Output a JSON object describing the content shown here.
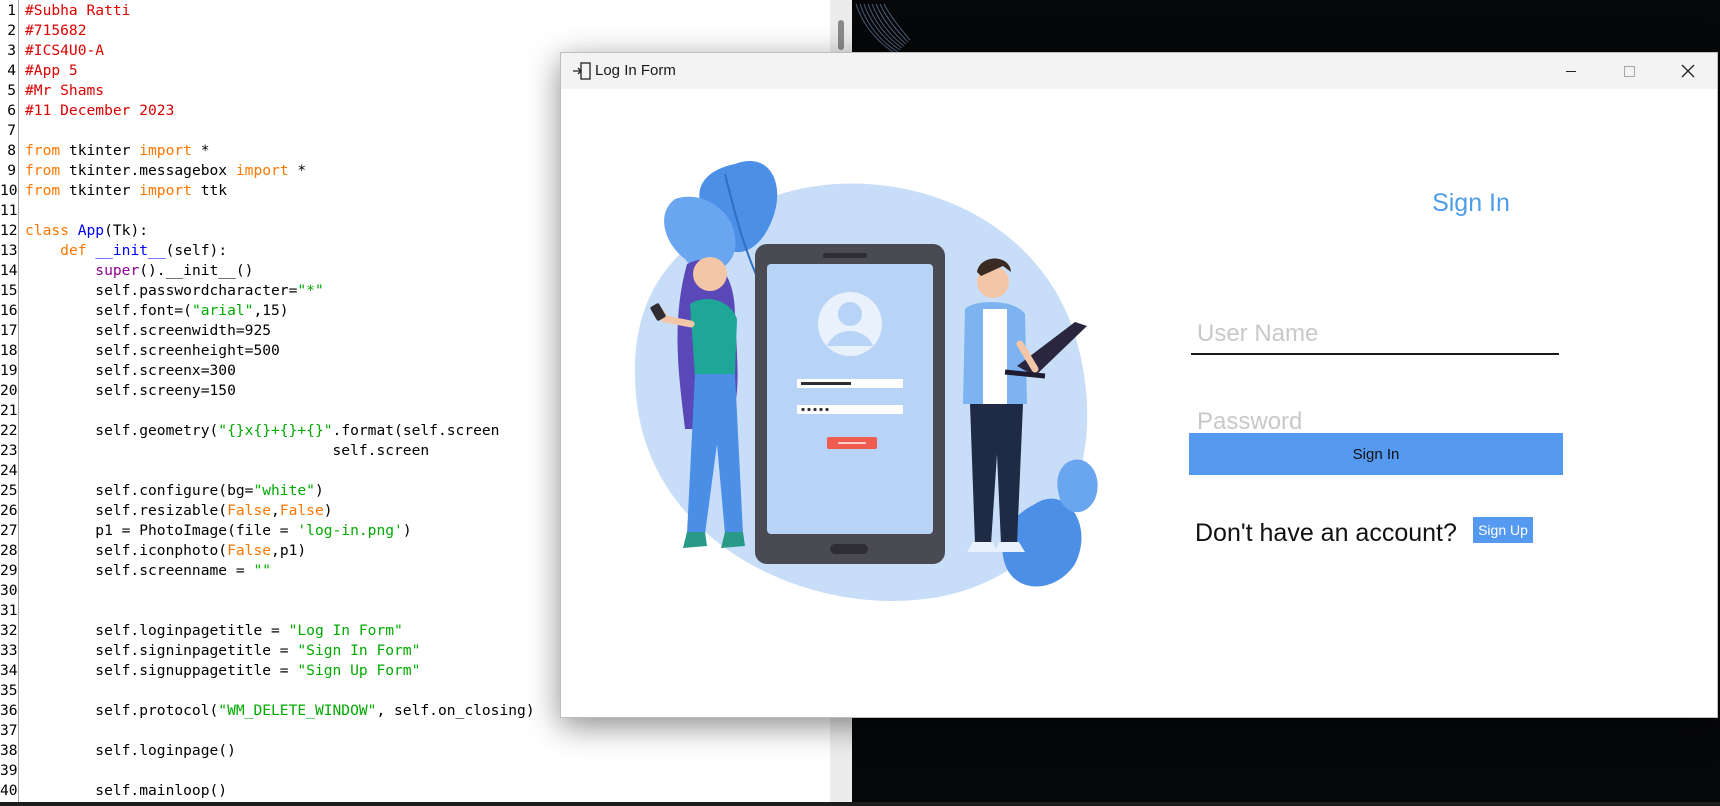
{
  "editor": {
    "lines": [
      {
        "n": "1",
        "segs": [
          {
            "t": "#Subha Ratti",
            "c": "com"
          }
        ]
      },
      {
        "n": "2",
        "segs": [
          {
            "t": "#715682",
            "c": "com"
          }
        ]
      },
      {
        "n": "3",
        "segs": [
          {
            "t": "#ICS4U0-A",
            "c": "com"
          }
        ]
      },
      {
        "n": "4",
        "segs": [
          {
            "t": "#App 5",
            "c": "com"
          }
        ]
      },
      {
        "n": "5",
        "segs": [
          {
            "t": "#Mr Shams",
            "c": "com"
          }
        ]
      },
      {
        "n": "6",
        "segs": [
          {
            "t": "#11 December 2023",
            "c": "com"
          }
        ]
      },
      {
        "n": "7",
        "segs": []
      },
      {
        "n": "8",
        "segs": [
          {
            "t": "from",
            "c": "kw"
          },
          {
            "t": " tkinter "
          },
          {
            "t": "import",
            "c": "kw"
          },
          {
            "t": " *"
          }
        ]
      },
      {
        "n": "9",
        "segs": [
          {
            "t": "from",
            "c": "kw"
          },
          {
            "t": " tkinter.messagebox "
          },
          {
            "t": "import",
            "c": "kw"
          },
          {
            "t": " *"
          }
        ]
      },
      {
        "n": "10",
        "segs": [
          {
            "t": "from",
            "c": "kw"
          },
          {
            "t": " tkinter "
          },
          {
            "t": "import",
            "c": "kw"
          },
          {
            "t": " ttk"
          }
        ]
      },
      {
        "n": "11",
        "segs": []
      },
      {
        "n": "12",
        "segs": [
          {
            "t": "class",
            "c": "kw"
          },
          {
            "t": " "
          },
          {
            "t": "App",
            "c": "def"
          },
          {
            "t": "(Tk):"
          }
        ]
      },
      {
        "n": "13",
        "segs": [
          {
            "t": "    "
          },
          {
            "t": "def",
            "c": "kw"
          },
          {
            "t": " "
          },
          {
            "t": "__init__",
            "c": "def"
          },
          {
            "t": "(self):"
          }
        ]
      },
      {
        "n": "14",
        "segs": [
          {
            "t": "        "
          },
          {
            "t": "super",
            "c": "blt"
          },
          {
            "t": "().__init__()"
          }
        ]
      },
      {
        "n": "15",
        "segs": [
          {
            "t": "        self.passwordcharacter="
          },
          {
            "t": "\"*\"",
            "c": "str"
          }
        ]
      },
      {
        "n": "16",
        "segs": [
          {
            "t": "        self.font=("
          },
          {
            "t": "\"arial\"",
            "c": "str"
          },
          {
            "t": ",15)"
          }
        ]
      },
      {
        "n": "17",
        "segs": [
          {
            "t": "        self.screenwidth=925"
          }
        ]
      },
      {
        "n": "18",
        "segs": [
          {
            "t": "        self.screenheight=500"
          }
        ]
      },
      {
        "n": "19",
        "segs": [
          {
            "t": "        self.screenx=300"
          }
        ]
      },
      {
        "n": "20",
        "segs": [
          {
            "t": "        self.screeny=150"
          }
        ]
      },
      {
        "n": "21",
        "segs": []
      },
      {
        "n": "22",
        "segs": [
          {
            "t": "        self.geometry("
          },
          {
            "t": "\"{}x{}+{}+{}\"",
            "c": "str"
          },
          {
            "t": ".format(self.screen"
          }
        ]
      },
      {
        "n": "23",
        "segs": [
          {
            "t": "                                   self.screen"
          }
        ]
      },
      {
        "n": "24",
        "segs": []
      },
      {
        "n": "25",
        "segs": [
          {
            "t": "        self.configure(bg="
          },
          {
            "t": "\"white\"",
            "c": "str"
          },
          {
            "t": ")"
          }
        ]
      },
      {
        "n": "26",
        "segs": [
          {
            "t": "        self.resizable("
          },
          {
            "t": "False",
            "c": "kw"
          },
          {
            "t": ","
          },
          {
            "t": "False",
            "c": "kw"
          },
          {
            "t": ")"
          }
        ]
      },
      {
        "n": "27",
        "segs": [
          {
            "t": "        p1 = PhotoImage(file = "
          },
          {
            "t": "'log-in.png'",
            "c": "str"
          },
          {
            "t": ")"
          }
        ]
      },
      {
        "n": "28",
        "segs": [
          {
            "t": "        self.iconphoto("
          },
          {
            "t": "False",
            "c": "kw"
          },
          {
            "t": ",p1)"
          }
        ]
      },
      {
        "n": "29",
        "segs": [
          {
            "t": "        self.screenname = "
          },
          {
            "t": "\"\"",
            "c": "str"
          }
        ]
      },
      {
        "n": "30",
        "segs": []
      },
      {
        "n": "31",
        "segs": []
      },
      {
        "n": "32",
        "segs": [
          {
            "t": "        self.loginpagetitle = "
          },
          {
            "t": "\"Log In Form\"",
            "c": "str"
          }
        ]
      },
      {
        "n": "33",
        "segs": [
          {
            "t": "        self.signinpagetitle = "
          },
          {
            "t": "\"Sign In Form\"",
            "c": "str"
          }
        ]
      },
      {
        "n": "34",
        "segs": [
          {
            "t": "        self.signuppagetitle = "
          },
          {
            "t": "\"Sign Up Form\"",
            "c": "str"
          }
        ]
      },
      {
        "n": "35",
        "segs": []
      },
      {
        "n": "36",
        "segs": [
          {
            "t": "        self.protocol("
          },
          {
            "t": "\"WM_DELETE_WINDOW\"",
            "c": "str"
          },
          {
            "t": ", self.on_closing)"
          }
        ]
      },
      {
        "n": "37",
        "segs": []
      },
      {
        "n": "38",
        "segs": [
          {
            "t": "        self.loginpage()"
          }
        ]
      },
      {
        "n": "39",
        "segs": []
      },
      {
        "n": "40",
        "segs": [
          {
            "t": "        self.mainloop()"
          }
        ]
      }
    ]
  },
  "app_window": {
    "title": "Log In Form",
    "icon": "login-door-icon",
    "controls": [
      "minimize-icon",
      "maximize-icon",
      "close-icon"
    ],
    "illustration": "phone-login-illustration",
    "heading": "Sign In",
    "username_placeholder": "User Name",
    "password_placeholder": "Password",
    "signin_button": "Sign In",
    "no_account_text": "Don't have an account?",
    "signup_button": "Sign Up",
    "colors": {
      "accent": "#559af0",
      "heading": "#4e9de9"
    }
  }
}
